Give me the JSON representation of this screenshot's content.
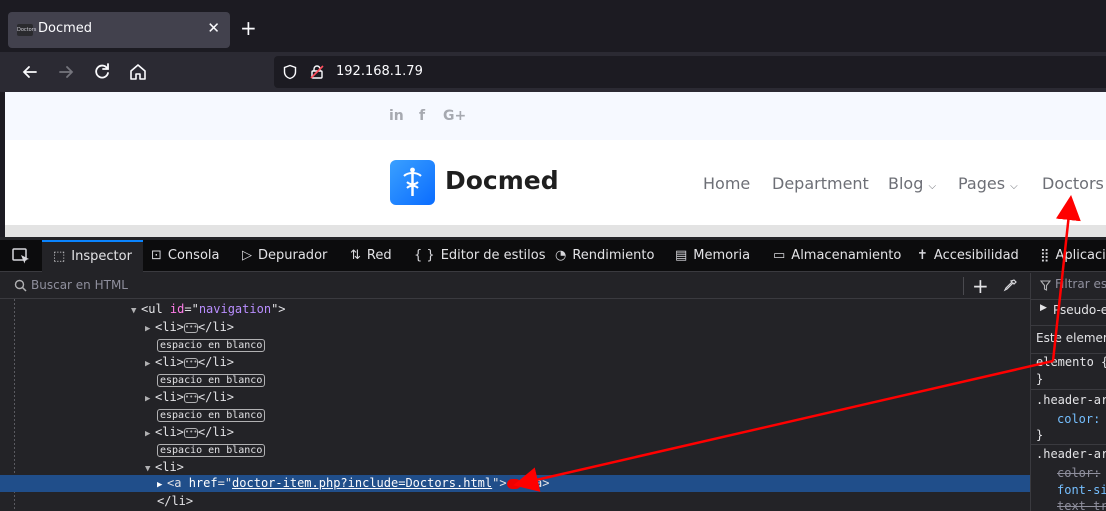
{
  "browser": {
    "tab": {
      "title": "Docmed",
      "favicon": "Doctors",
      "close": "✕"
    },
    "new_tab": "+",
    "url": "192.168.1.79"
  },
  "website": {
    "social": [
      "in",
      "f",
      "G+"
    ],
    "brand": "Docmed",
    "menu": [
      "Home",
      "Department",
      "Blog",
      "Pages",
      "Doctors"
    ],
    "caret": "⌵"
  },
  "devtools": {
    "tabs": [
      {
        "label": "Inspector",
        "icon": "inspector-icon",
        "glyph": "⬚"
      },
      {
        "label": "Consola",
        "icon": "console-icon",
        "glyph": "⊡"
      },
      {
        "label": "Depurador",
        "icon": "debugger-icon",
        "glyph": "▷"
      },
      {
        "label": "Red",
        "icon": "network-icon",
        "glyph": "⇅"
      },
      {
        "label": "Editor de estilos",
        "icon": "style-editor-icon",
        "glyph": "{ }"
      },
      {
        "label": "Rendimiento",
        "icon": "performance-icon",
        "glyph": "◔"
      },
      {
        "label": "Memoria",
        "icon": "memory-icon",
        "glyph": "▤"
      },
      {
        "label": "Almacenamiento",
        "icon": "storage-icon",
        "glyph": "▭"
      },
      {
        "label": "Accesibilidad",
        "icon": "accessibility-icon",
        "glyph": "✝"
      },
      {
        "label": "Aplicación",
        "icon": "application-icon",
        "glyph": "⣿"
      }
    ],
    "search_placeholder": "Buscar en HTML",
    "plus": "+",
    "tree": {
      "ul_open": {
        "tag_open": "<ul ",
        "attr": "id",
        "eq": "=\"",
        "value": "navigation",
        "close": "\">"
      },
      "li_collapsed": {
        "open": "<li>",
        "close": "</li>"
      },
      "whitespace": "espacio en blanco",
      "li_open": "<li>",
      "anchor": {
        "open": "<a ",
        "attr": "href",
        "eq": "=\"",
        "value": "doctor-item.php?include=Doctors.html",
        "mid": "\">",
        "close": "</a>"
      },
      "li_close": "</li>"
    },
    "rules": {
      "filter": "Filtrar estilos",
      "pseudo": "Pseudo-elementos",
      "este": "Este elemento",
      "elemento": "elemento {",
      "brace_close": "}",
      "sel1": ".header-area",
      "color1": "color:",
      "sel2": ".header-area",
      "color2": "color:",
      "font_size": "font-size:",
      "text_transform": "text-transform:"
    }
  },
  "colors": {
    "accent": "#0a84ff",
    "selection": "#204e8a",
    "annotation_arrow": "#ff0000",
    "brand_blue": "#1a8cff"
  }
}
